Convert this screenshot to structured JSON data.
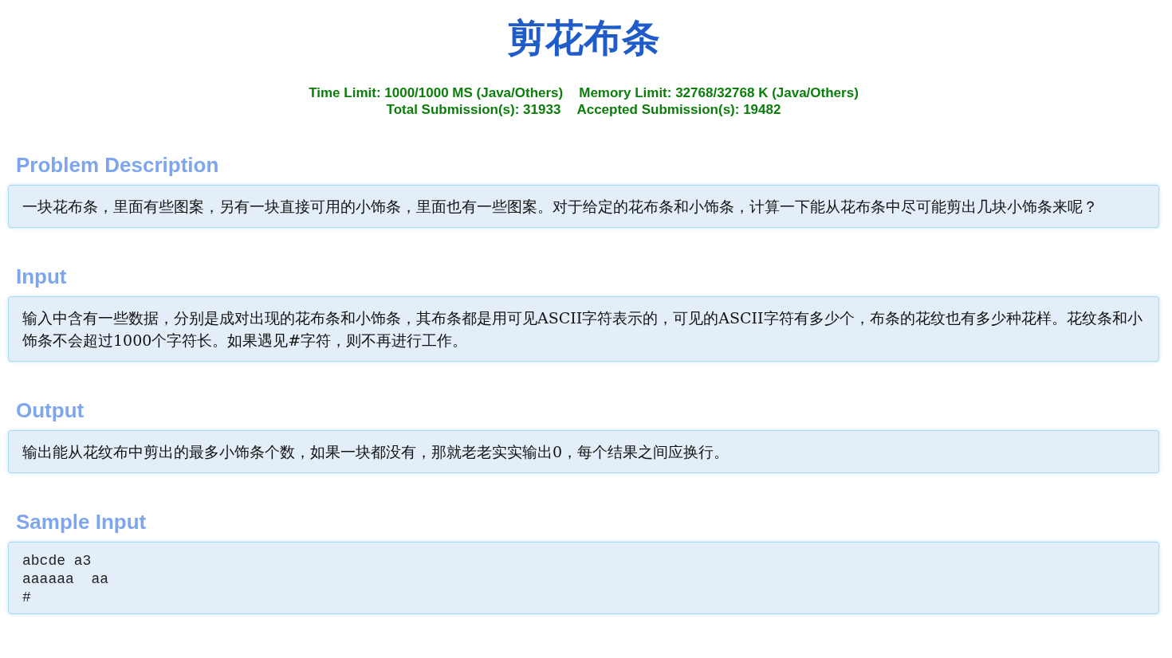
{
  "title": "剪花布条",
  "stats": [
    [
      "Time Limit: 1000/1000 MS (Java/Others)",
      "Memory Limit: 32768/32768 K (Java/Others)"
    ],
    [
      "Total Submission(s): 31933",
      "Accepted Submission(s): 19482"
    ]
  ],
  "sections": [
    {
      "heading": "Problem Description",
      "kind": "text",
      "body": "一块花布条，里面有些图案，另有一块直接可用的小饰条，里面也有一些图案。对于给定的花布条和小饰条，计算一下能从花布条中尽可能剪出几块小饰条来呢？"
    },
    {
      "heading": "Input",
      "kind": "text",
      "body": "输入中含有一些数据，分别是成对出现的花布条和小饰条，其布条都是用可见ASCII字符表示的，可见的ASCII字符有多少个，布条的花纹也有多少种花样。花纹条和小饰条不会超过1000个字符长。如果遇见#字符，则不再进行工作。"
    },
    {
      "heading": "Output",
      "kind": "text",
      "body": "输出能从花纹布中剪出的最多小饰条个数，如果一块都没有，那就老老实实输出0，每个结果之间应换行。"
    },
    {
      "heading": "Sample Input",
      "kind": "code",
      "lines": [
        "abcde a3",
        "aaaaaa  aa",
        "#"
      ]
    }
  ]
}
